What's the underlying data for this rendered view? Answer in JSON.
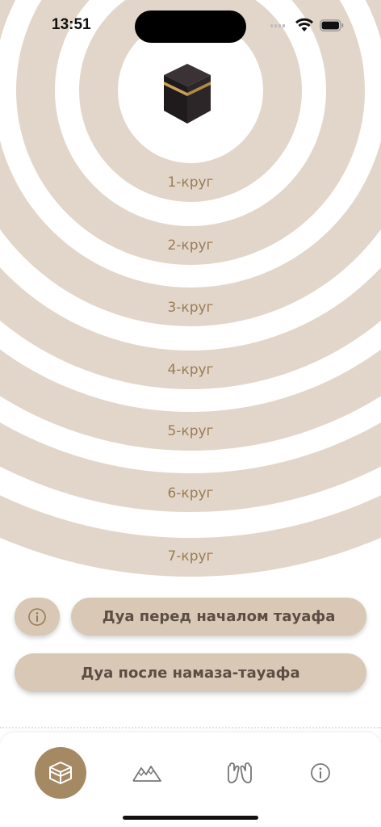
{
  "status_bar": {
    "time": "13:51"
  },
  "rounds": [
    {
      "label": "1-круг"
    },
    {
      "label": "2-круг"
    },
    {
      "label": "3-круг"
    },
    {
      "label": "4-круг"
    },
    {
      "label": "5-круг"
    },
    {
      "label": "6-круг"
    },
    {
      "label": "7-круг"
    }
  ],
  "buttons": {
    "dua_before": "Дуа перед началом тауафа",
    "dua_after": "Дуа после намаза-тауафа"
  },
  "tabs": [
    {
      "icon": "kaaba-icon",
      "active": true
    },
    {
      "icon": "mountains-icon",
      "active": false
    },
    {
      "icon": "praying-hands-icon",
      "active": false
    },
    {
      "icon": "info-icon",
      "active": false
    }
  ],
  "colors": {
    "ring": "#e2d6ca",
    "label": "#9c7c56",
    "button": "#d9c8b5",
    "button_text": "#5c4e44",
    "tab_active": "#a58963"
  }
}
